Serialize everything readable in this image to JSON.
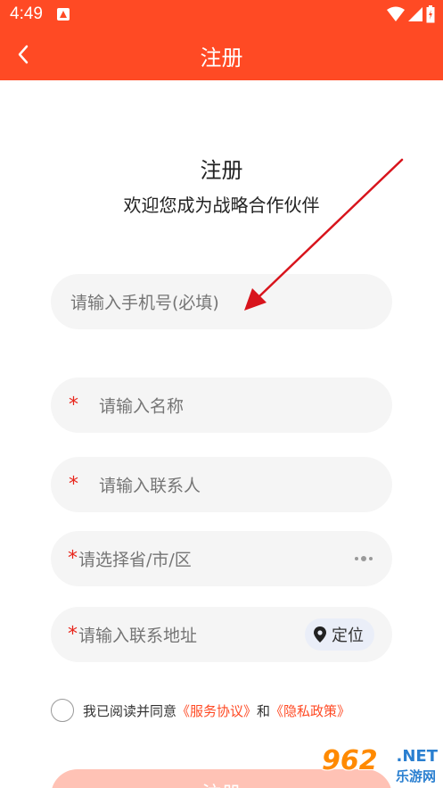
{
  "status_bar": {
    "time": "4:49"
  },
  "nav": {
    "title": "注册"
  },
  "header": {
    "title": "注册",
    "subtitle": "欢迎您成为战略合作伙伴"
  },
  "form": {
    "phone_placeholder": "请输入手机号(必填)",
    "required_mark": "*",
    "name_placeholder": "请输入名称",
    "contact_placeholder": "请输入联系人",
    "region_placeholder": "请选择省/市/区",
    "address_placeholder": "请输入联系地址",
    "locate_label": "定位"
  },
  "agreement": {
    "prefix": "我已阅读并同意",
    "service_link": "《服务协议》",
    "and": "和",
    "privacy_link": "《隐私政策》"
  },
  "submit": {
    "label": "注册"
  },
  "watermark": {
    "logo": "962",
    "domain": ".NET",
    "sub": "乐游网"
  },
  "colors": {
    "brand": "#ff4a24",
    "annotation_arrow": "#d8141c",
    "field_bg": "#f5f5f5",
    "required": "#e8261c"
  },
  "icons": [
    "back-arrow-icon",
    "wifi-icon",
    "signal-icon",
    "battery-icon",
    "location-pin-icon",
    "more-dots-icon"
  ]
}
